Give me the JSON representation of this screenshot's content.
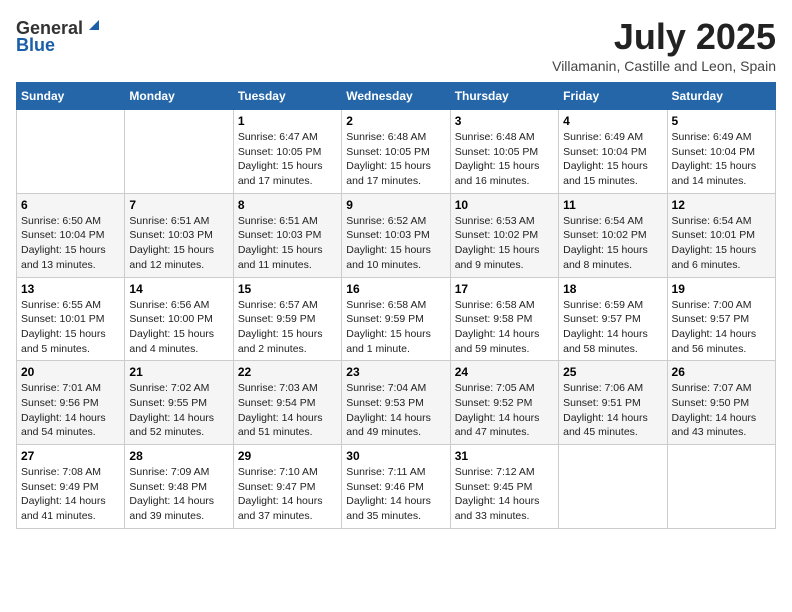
{
  "logo": {
    "general": "General",
    "blue": "Blue"
  },
  "title": {
    "month_year": "July 2025",
    "location": "Villamanin, Castille and Leon, Spain"
  },
  "days_of_week": [
    "Sunday",
    "Monday",
    "Tuesday",
    "Wednesday",
    "Thursday",
    "Friday",
    "Saturday"
  ],
  "weeks": [
    [
      {
        "day": "",
        "info": ""
      },
      {
        "day": "",
        "info": ""
      },
      {
        "day": "1",
        "info": "Sunrise: 6:47 AM\nSunset: 10:05 PM\nDaylight: 15 hours and 17 minutes."
      },
      {
        "day": "2",
        "info": "Sunrise: 6:48 AM\nSunset: 10:05 PM\nDaylight: 15 hours and 17 minutes."
      },
      {
        "day": "3",
        "info": "Sunrise: 6:48 AM\nSunset: 10:05 PM\nDaylight: 15 hours and 16 minutes."
      },
      {
        "day": "4",
        "info": "Sunrise: 6:49 AM\nSunset: 10:04 PM\nDaylight: 15 hours and 15 minutes."
      },
      {
        "day": "5",
        "info": "Sunrise: 6:49 AM\nSunset: 10:04 PM\nDaylight: 15 hours and 14 minutes."
      }
    ],
    [
      {
        "day": "6",
        "info": "Sunrise: 6:50 AM\nSunset: 10:04 PM\nDaylight: 15 hours and 13 minutes."
      },
      {
        "day": "7",
        "info": "Sunrise: 6:51 AM\nSunset: 10:03 PM\nDaylight: 15 hours and 12 minutes."
      },
      {
        "day": "8",
        "info": "Sunrise: 6:51 AM\nSunset: 10:03 PM\nDaylight: 15 hours and 11 minutes."
      },
      {
        "day": "9",
        "info": "Sunrise: 6:52 AM\nSunset: 10:03 PM\nDaylight: 15 hours and 10 minutes."
      },
      {
        "day": "10",
        "info": "Sunrise: 6:53 AM\nSunset: 10:02 PM\nDaylight: 15 hours and 9 minutes."
      },
      {
        "day": "11",
        "info": "Sunrise: 6:54 AM\nSunset: 10:02 PM\nDaylight: 15 hours and 8 minutes."
      },
      {
        "day": "12",
        "info": "Sunrise: 6:54 AM\nSunset: 10:01 PM\nDaylight: 15 hours and 6 minutes."
      }
    ],
    [
      {
        "day": "13",
        "info": "Sunrise: 6:55 AM\nSunset: 10:01 PM\nDaylight: 15 hours and 5 minutes."
      },
      {
        "day": "14",
        "info": "Sunrise: 6:56 AM\nSunset: 10:00 PM\nDaylight: 15 hours and 4 minutes."
      },
      {
        "day": "15",
        "info": "Sunrise: 6:57 AM\nSunset: 9:59 PM\nDaylight: 15 hours and 2 minutes."
      },
      {
        "day": "16",
        "info": "Sunrise: 6:58 AM\nSunset: 9:59 PM\nDaylight: 15 hours and 1 minute."
      },
      {
        "day": "17",
        "info": "Sunrise: 6:58 AM\nSunset: 9:58 PM\nDaylight: 14 hours and 59 minutes."
      },
      {
        "day": "18",
        "info": "Sunrise: 6:59 AM\nSunset: 9:57 PM\nDaylight: 14 hours and 58 minutes."
      },
      {
        "day": "19",
        "info": "Sunrise: 7:00 AM\nSunset: 9:57 PM\nDaylight: 14 hours and 56 minutes."
      }
    ],
    [
      {
        "day": "20",
        "info": "Sunrise: 7:01 AM\nSunset: 9:56 PM\nDaylight: 14 hours and 54 minutes."
      },
      {
        "day": "21",
        "info": "Sunrise: 7:02 AM\nSunset: 9:55 PM\nDaylight: 14 hours and 52 minutes."
      },
      {
        "day": "22",
        "info": "Sunrise: 7:03 AM\nSunset: 9:54 PM\nDaylight: 14 hours and 51 minutes."
      },
      {
        "day": "23",
        "info": "Sunrise: 7:04 AM\nSunset: 9:53 PM\nDaylight: 14 hours and 49 minutes."
      },
      {
        "day": "24",
        "info": "Sunrise: 7:05 AM\nSunset: 9:52 PM\nDaylight: 14 hours and 47 minutes."
      },
      {
        "day": "25",
        "info": "Sunrise: 7:06 AM\nSunset: 9:51 PM\nDaylight: 14 hours and 45 minutes."
      },
      {
        "day": "26",
        "info": "Sunrise: 7:07 AM\nSunset: 9:50 PM\nDaylight: 14 hours and 43 minutes."
      }
    ],
    [
      {
        "day": "27",
        "info": "Sunrise: 7:08 AM\nSunset: 9:49 PM\nDaylight: 14 hours and 41 minutes."
      },
      {
        "day": "28",
        "info": "Sunrise: 7:09 AM\nSunset: 9:48 PM\nDaylight: 14 hours and 39 minutes."
      },
      {
        "day": "29",
        "info": "Sunrise: 7:10 AM\nSunset: 9:47 PM\nDaylight: 14 hours and 37 minutes."
      },
      {
        "day": "30",
        "info": "Sunrise: 7:11 AM\nSunset: 9:46 PM\nDaylight: 14 hours and 35 minutes."
      },
      {
        "day": "31",
        "info": "Sunrise: 7:12 AM\nSunset: 9:45 PM\nDaylight: 14 hours and 33 minutes."
      },
      {
        "day": "",
        "info": ""
      },
      {
        "day": "",
        "info": ""
      }
    ]
  ]
}
